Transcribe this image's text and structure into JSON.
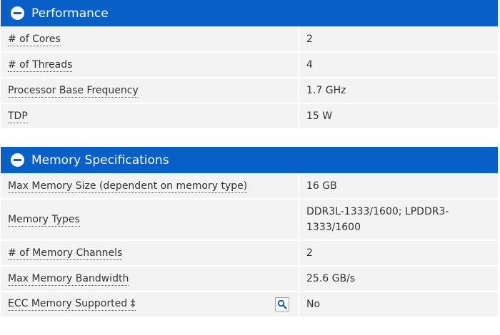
{
  "performance": {
    "title": "Performance",
    "rows": [
      {
        "label": "# of Cores",
        "value": "2"
      },
      {
        "label": "# of Threads",
        "value": "4"
      },
      {
        "label": "Processor Base Frequency",
        "value": "1.7 GHz"
      },
      {
        "label": "TDP",
        "value": "15 W"
      }
    ]
  },
  "memory": {
    "title": "Memory Specifications",
    "rows": [
      {
        "label": "Max Memory Size (dependent on memory type)",
        "value": "16 GB"
      },
      {
        "label": "Memory Types",
        "value": "DDR3L-1333/1600; LPDDR3-1333/1600"
      },
      {
        "label": "# of Memory Channels",
        "value": "2"
      },
      {
        "label": "Max Memory Bandwidth",
        "value": "25.6 GB/s"
      },
      {
        "label": "ECC Memory Supported ‡",
        "value": "No"
      }
    ]
  },
  "icons": {
    "collapse": "minus-circle-icon",
    "search": "magnifier-icon"
  },
  "colors": {
    "header_bg": "#0860c7",
    "row_bg": "#f3f3f3"
  }
}
